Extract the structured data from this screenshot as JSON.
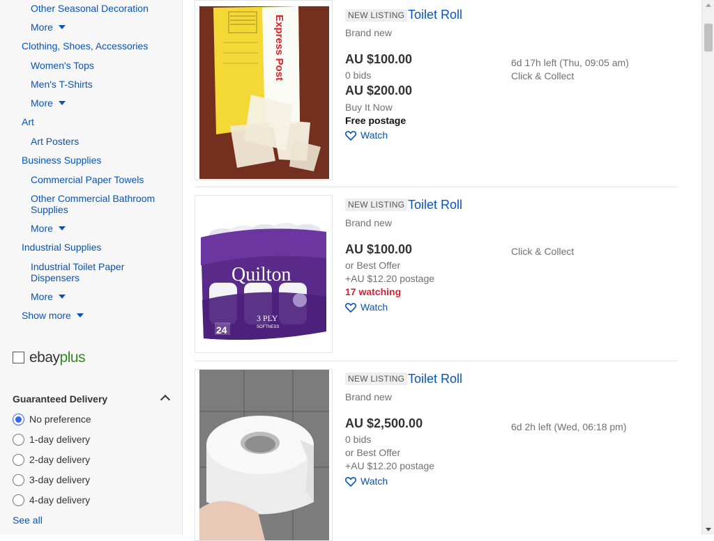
{
  "sidebar": {
    "categories": {
      "seasonal": "Other Seasonal Decoration",
      "more1": "More",
      "clothing": "Clothing, Shoes, Accessories",
      "womens_tops": "Women's Tops",
      "mens_tshirts": "Men's T-Shirts",
      "more2": "More",
      "art": "Art",
      "art_posters": "Art Posters",
      "business_supplies": "Business Supplies",
      "commercial_paper_towels": "Commercial Paper Towels",
      "other_commercial_bathroom": "Other Commercial Bathroom Supplies",
      "more3": "More",
      "industrial_supplies": "Industrial Supplies",
      "industrial_toilet_paper": "Industrial Toilet Paper Dispensers",
      "more4": "More",
      "show_more": "Show more"
    },
    "ebayplus": {
      "part1": "ebay",
      "part2": "plus"
    },
    "guaranteed_delivery": {
      "title": "Guaranteed Delivery",
      "options": [
        "No preference",
        "1-day delivery",
        "2-day delivery",
        "3-day delivery",
        "4-day delivery"
      ],
      "selected": "No preference",
      "see_all": "See all"
    }
  },
  "listings": [
    {
      "badge": "NEW LISTING",
      "title": "Toilet Roll",
      "condition": "Brand new",
      "price": "AU $100.00",
      "bids": "0 bids",
      "price2": "AU $200.00",
      "buy_it_now": "Buy It Now",
      "postage": "Free postage",
      "time_left": "6d 17h left (Thu, 09:05 am)",
      "collect": "Click & Collect",
      "watch": "Watch",
      "image_text": "Express Post"
    },
    {
      "badge": "NEW LISTING",
      "title": "Toilet Roll",
      "condition": "Brand new",
      "price": "AU $100.00",
      "best_offer": "or Best Offer",
      "postage": "+AU $12.20 postage",
      "watching": "17 watching",
      "collect": "Click & Collect",
      "watch": "Watch",
      "image_brand": "Quilton",
      "image_ply": "3 PLY",
      "image_softness": "SOFTNESS",
      "image_count": "24"
    },
    {
      "badge": "NEW LISTING",
      "title": "Toilet Roll",
      "condition": "Brand new",
      "price": "AU $2,500.00",
      "bids": "0 bids",
      "best_offer": "or Best Offer",
      "postage": "+AU $12.20 postage",
      "time_left": "6d 2h left (Wed, 06:18 pm)",
      "watch": "Watch"
    }
  ],
  "colors": {
    "link": "#0654ba",
    "watching_red": "#dd1e31",
    "radio_blue": "#3665f3",
    "plus_green": "#2f8a1e"
  }
}
